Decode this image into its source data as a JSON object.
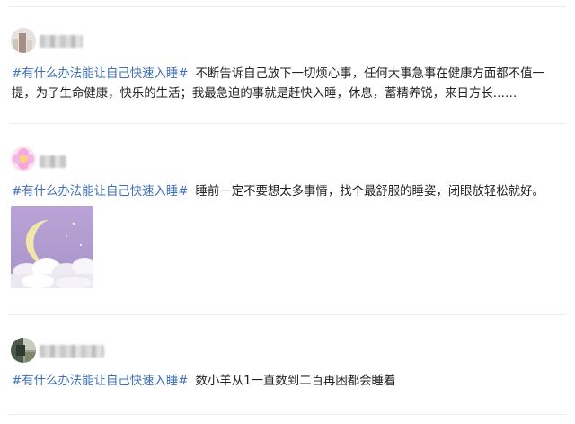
{
  "posts": [
    {
      "hashtag": "#有什么办法能让自己快速入睡#",
      "body": "不断告诉自己放下一切烦心事，任何大事急事在健康方面都不值一提，为了生命健康，快乐的生活；我最急迫的事就是赶快入睡，休息，蓄精养锐，来日方长……"
    },
    {
      "hashtag": "#有什么办法能让自己快速入睡#",
      "body": "睡前一定不要想太多事情，找个最舒服的睡姿，闭眼放轻松就好。"
    },
    {
      "hashtag": "#有什么办法能让自己快速入睡#",
      "body": "数小羊从1一直数到二百再困都会睡着"
    }
  ],
  "colors": {
    "hashtag": "#3d6fb6",
    "separator": "#ececec"
  }
}
